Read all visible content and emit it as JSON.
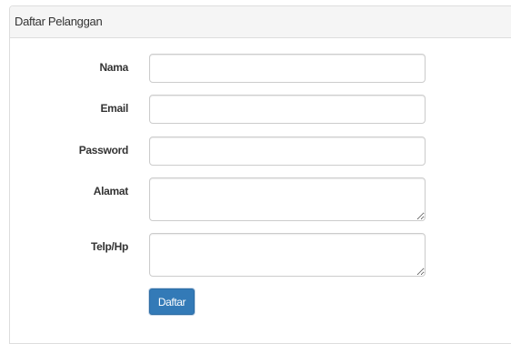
{
  "panel": {
    "title": "Daftar Pelanggan"
  },
  "form": {
    "fields": [
      {
        "label": "Nama",
        "value": "",
        "placeholder": ""
      },
      {
        "label": "Email",
        "value": "",
        "placeholder": ""
      },
      {
        "label": "Password",
        "value": "",
        "placeholder": ""
      },
      {
        "label": "Alamat",
        "value": "",
        "placeholder": ""
      },
      {
        "label": "Telp/Hp",
        "value": "",
        "placeholder": ""
      }
    ],
    "submit_label": "Daftar"
  },
  "colors": {
    "primary_button": "#337ab7",
    "panel_heading_bg": "#f5f5f5",
    "border": "#dddddd"
  }
}
